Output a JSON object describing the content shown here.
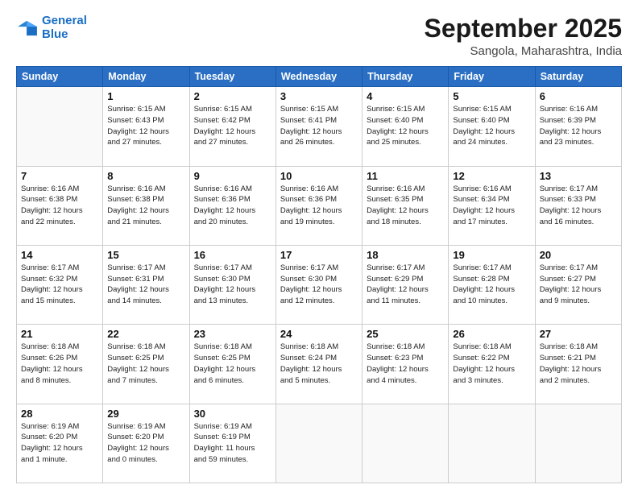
{
  "header": {
    "logo_line1": "General",
    "logo_line2": "Blue",
    "month": "September 2025",
    "location": "Sangola, Maharashtra, India"
  },
  "weekdays": [
    "Sunday",
    "Monday",
    "Tuesday",
    "Wednesday",
    "Thursday",
    "Friday",
    "Saturday"
  ],
  "weeks": [
    [
      {
        "day": "",
        "info": ""
      },
      {
        "day": "1",
        "info": "Sunrise: 6:15 AM\nSunset: 6:43 PM\nDaylight: 12 hours\nand 27 minutes."
      },
      {
        "day": "2",
        "info": "Sunrise: 6:15 AM\nSunset: 6:42 PM\nDaylight: 12 hours\nand 27 minutes."
      },
      {
        "day": "3",
        "info": "Sunrise: 6:15 AM\nSunset: 6:41 PM\nDaylight: 12 hours\nand 26 minutes."
      },
      {
        "day": "4",
        "info": "Sunrise: 6:15 AM\nSunset: 6:40 PM\nDaylight: 12 hours\nand 25 minutes."
      },
      {
        "day": "5",
        "info": "Sunrise: 6:15 AM\nSunset: 6:40 PM\nDaylight: 12 hours\nand 24 minutes."
      },
      {
        "day": "6",
        "info": "Sunrise: 6:16 AM\nSunset: 6:39 PM\nDaylight: 12 hours\nand 23 minutes."
      }
    ],
    [
      {
        "day": "7",
        "info": "Sunrise: 6:16 AM\nSunset: 6:38 PM\nDaylight: 12 hours\nand 22 minutes."
      },
      {
        "day": "8",
        "info": "Sunrise: 6:16 AM\nSunset: 6:38 PM\nDaylight: 12 hours\nand 21 minutes."
      },
      {
        "day": "9",
        "info": "Sunrise: 6:16 AM\nSunset: 6:36 PM\nDaylight: 12 hours\nand 20 minutes."
      },
      {
        "day": "10",
        "info": "Sunrise: 6:16 AM\nSunset: 6:36 PM\nDaylight: 12 hours\nand 19 minutes."
      },
      {
        "day": "11",
        "info": "Sunrise: 6:16 AM\nSunset: 6:35 PM\nDaylight: 12 hours\nand 18 minutes."
      },
      {
        "day": "12",
        "info": "Sunrise: 6:16 AM\nSunset: 6:34 PM\nDaylight: 12 hours\nand 17 minutes."
      },
      {
        "day": "13",
        "info": "Sunrise: 6:17 AM\nSunset: 6:33 PM\nDaylight: 12 hours\nand 16 minutes."
      }
    ],
    [
      {
        "day": "14",
        "info": "Sunrise: 6:17 AM\nSunset: 6:32 PM\nDaylight: 12 hours\nand 15 minutes."
      },
      {
        "day": "15",
        "info": "Sunrise: 6:17 AM\nSunset: 6:31 PM\nDaylight: 12 hours\nand 14 minutes."
      },
      {
        "day": "16",
        "info": "Sunrise: 6:17 AM\nSunset: 6:30 PM\nDaylight: 12 hours\nand 13 minutes."
      },
      {
        "day": "17",
        "info": "Sunrise: 6:17 AM\nSunset: 6:30 PM\nDaylight: 12 hours\nand 12 minutes."
      },
      {
        "day": "18",
        "info": "Sunrise: 6:17 AM\nSunset: 6:29 PM\nDaylight: 12 hours\nand 11 minutes."
      },
      {
        "day": "19",
        "info": "Sunrise: 6:17 AM\nSunset: 6:28 PM\nDaylight: 12 hours\nand 10 minutes."
      },
      {
        "day": "20",
        "info": "Sunrise: 6:17 AM\nSunset: 6:27 PM\nDaylight: 12 hours\nand 9 minutes."
      }
    ],
    [
      {
        "day": "21",
        "info": "Sunrise: 6:18 AM\nSunset: 6:26 PM\nDaylight: 12 hours\nand 8 minutes."
      },
      {
        "day": "22",
        "info": "Sunrise: 6:18 AM\nSunset: 6:25 PM\nDaylight: 12 hours\nand 7 minutes."
      },
      {
        "day": "23",
        "info": "Sunrise: 6:18 AM\nSunset: 6:25 PM\nDaylight: 12 hours\nand 6 minutes."
      },
      {
        "day": "24",
        "info": "Sunrise: 6:18 AM\nSunset: 6:24 PM\nDaylight: 12 hours\nand 5 minutes."
      },
      {
        "day": "25",
        "info": "Sunrise: 6:18 AM\nSunset: 6:23 PM\nDaylight: 12 hours\nand 4 minutes."
      },
      {
        "day": "26",
        "info": "Sunrise: 6:18 AM\nSunset: 6:22 PM\nDaylight: 12 hours\nand 3 minutes."
      },
      {
        "day": "27",
        "info": "Sunrise: 6:18 AM\nSunset: 6:21 PM\nDaylight: 12 hours\nand 2 minutes."
      }
    ],
    [
      {
        "day": "28",
        "info": "Sunrise: 6:19 AM\nSunset: 6:20 PM\nDaylight: 12 hours\nand 1 minute."
      },
      {
        "day": "29",
        "info": "Sunrise: 6:19 AM\nSunset: 6:20 PM\nDaylight: 12 hours\nand 0 minutes."
      },
      {
        "day": "30",
        "info": "Sunrise: 6:19 AM\nSunset: 6:19 PM\nDaylight: 11 hours\nand 59 minutes."
      },
      {
        "day": "",
        "info": ""
      },
      {
        "day": "",
        "info": ""
      },
      {
        "day": "",
        "info": ""
      },
      {
        "day": "",
        "info": ""
      }
    ]
  ]
}
